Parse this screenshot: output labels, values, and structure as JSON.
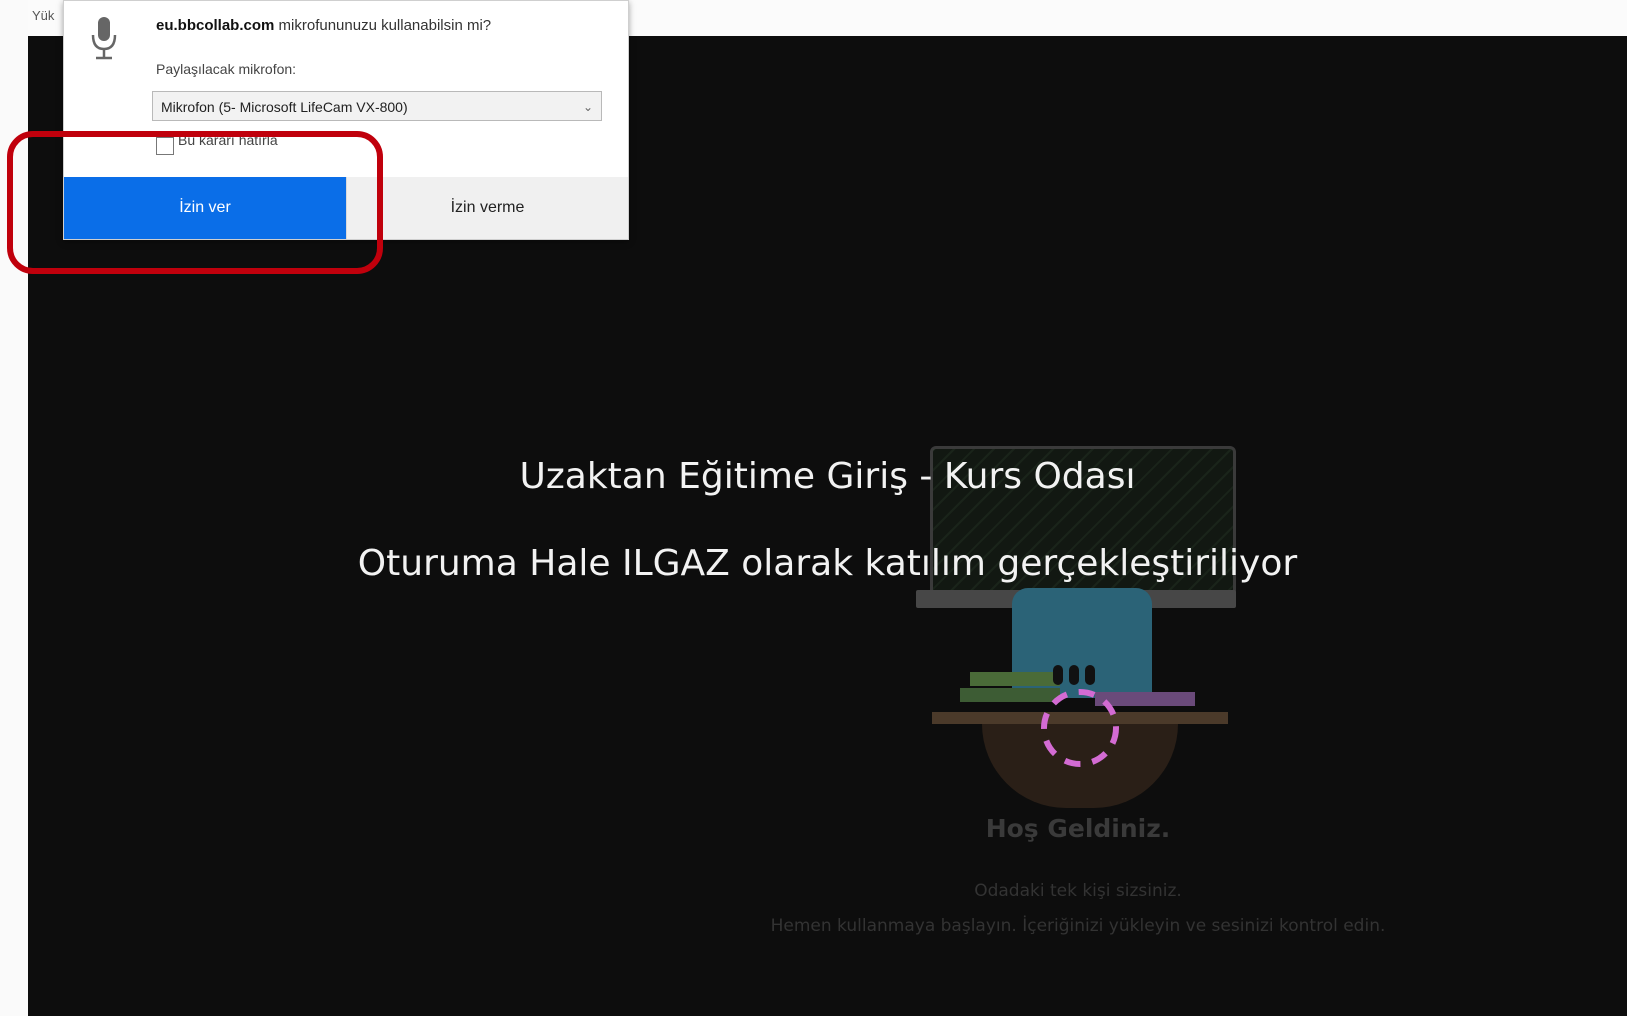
{
  "browser": {
    "status_text": "Yük"
  },
  "permission_prompt": {
    "site": "eu.bbcollab.com",
    "question": " mikrofununuzu kullanabilsin mi?",
    "share_label": "Paylaşılacak mikrofon:",
    "selected_microphone": "Mikrofon (5- Microsoft LifeCam VX-800)",
    "remember_label": "Bu kararı hatırla",
    "allow_label": "İzin ver",
    "deny_label": "İzin verme",
    "icon": "microphone-icon"
  },
  "session": {
    "title": "Uzaktan Eğitime Giriş - Kurs Odası",
    "joining_text": "Oturuma Hale ILGAZ olarak katılım gerçekleştiriliyor",
    "welcome": "Hoş Geldiniz.",
    "alone_text": "Odadaki tek kişi sizsiniz.",
    "start_text": "Hemen kullanmaya başlayın. İçeriğinizi yükleyin ve sesinizi kontrol edin."
  },
  "colors": {
    "allow_button": "#0a6ee8",
    "highlight": "#c0000c",
    "background": "#0d0d0d",
    "spinner": "#d36bd3"
  }
}
